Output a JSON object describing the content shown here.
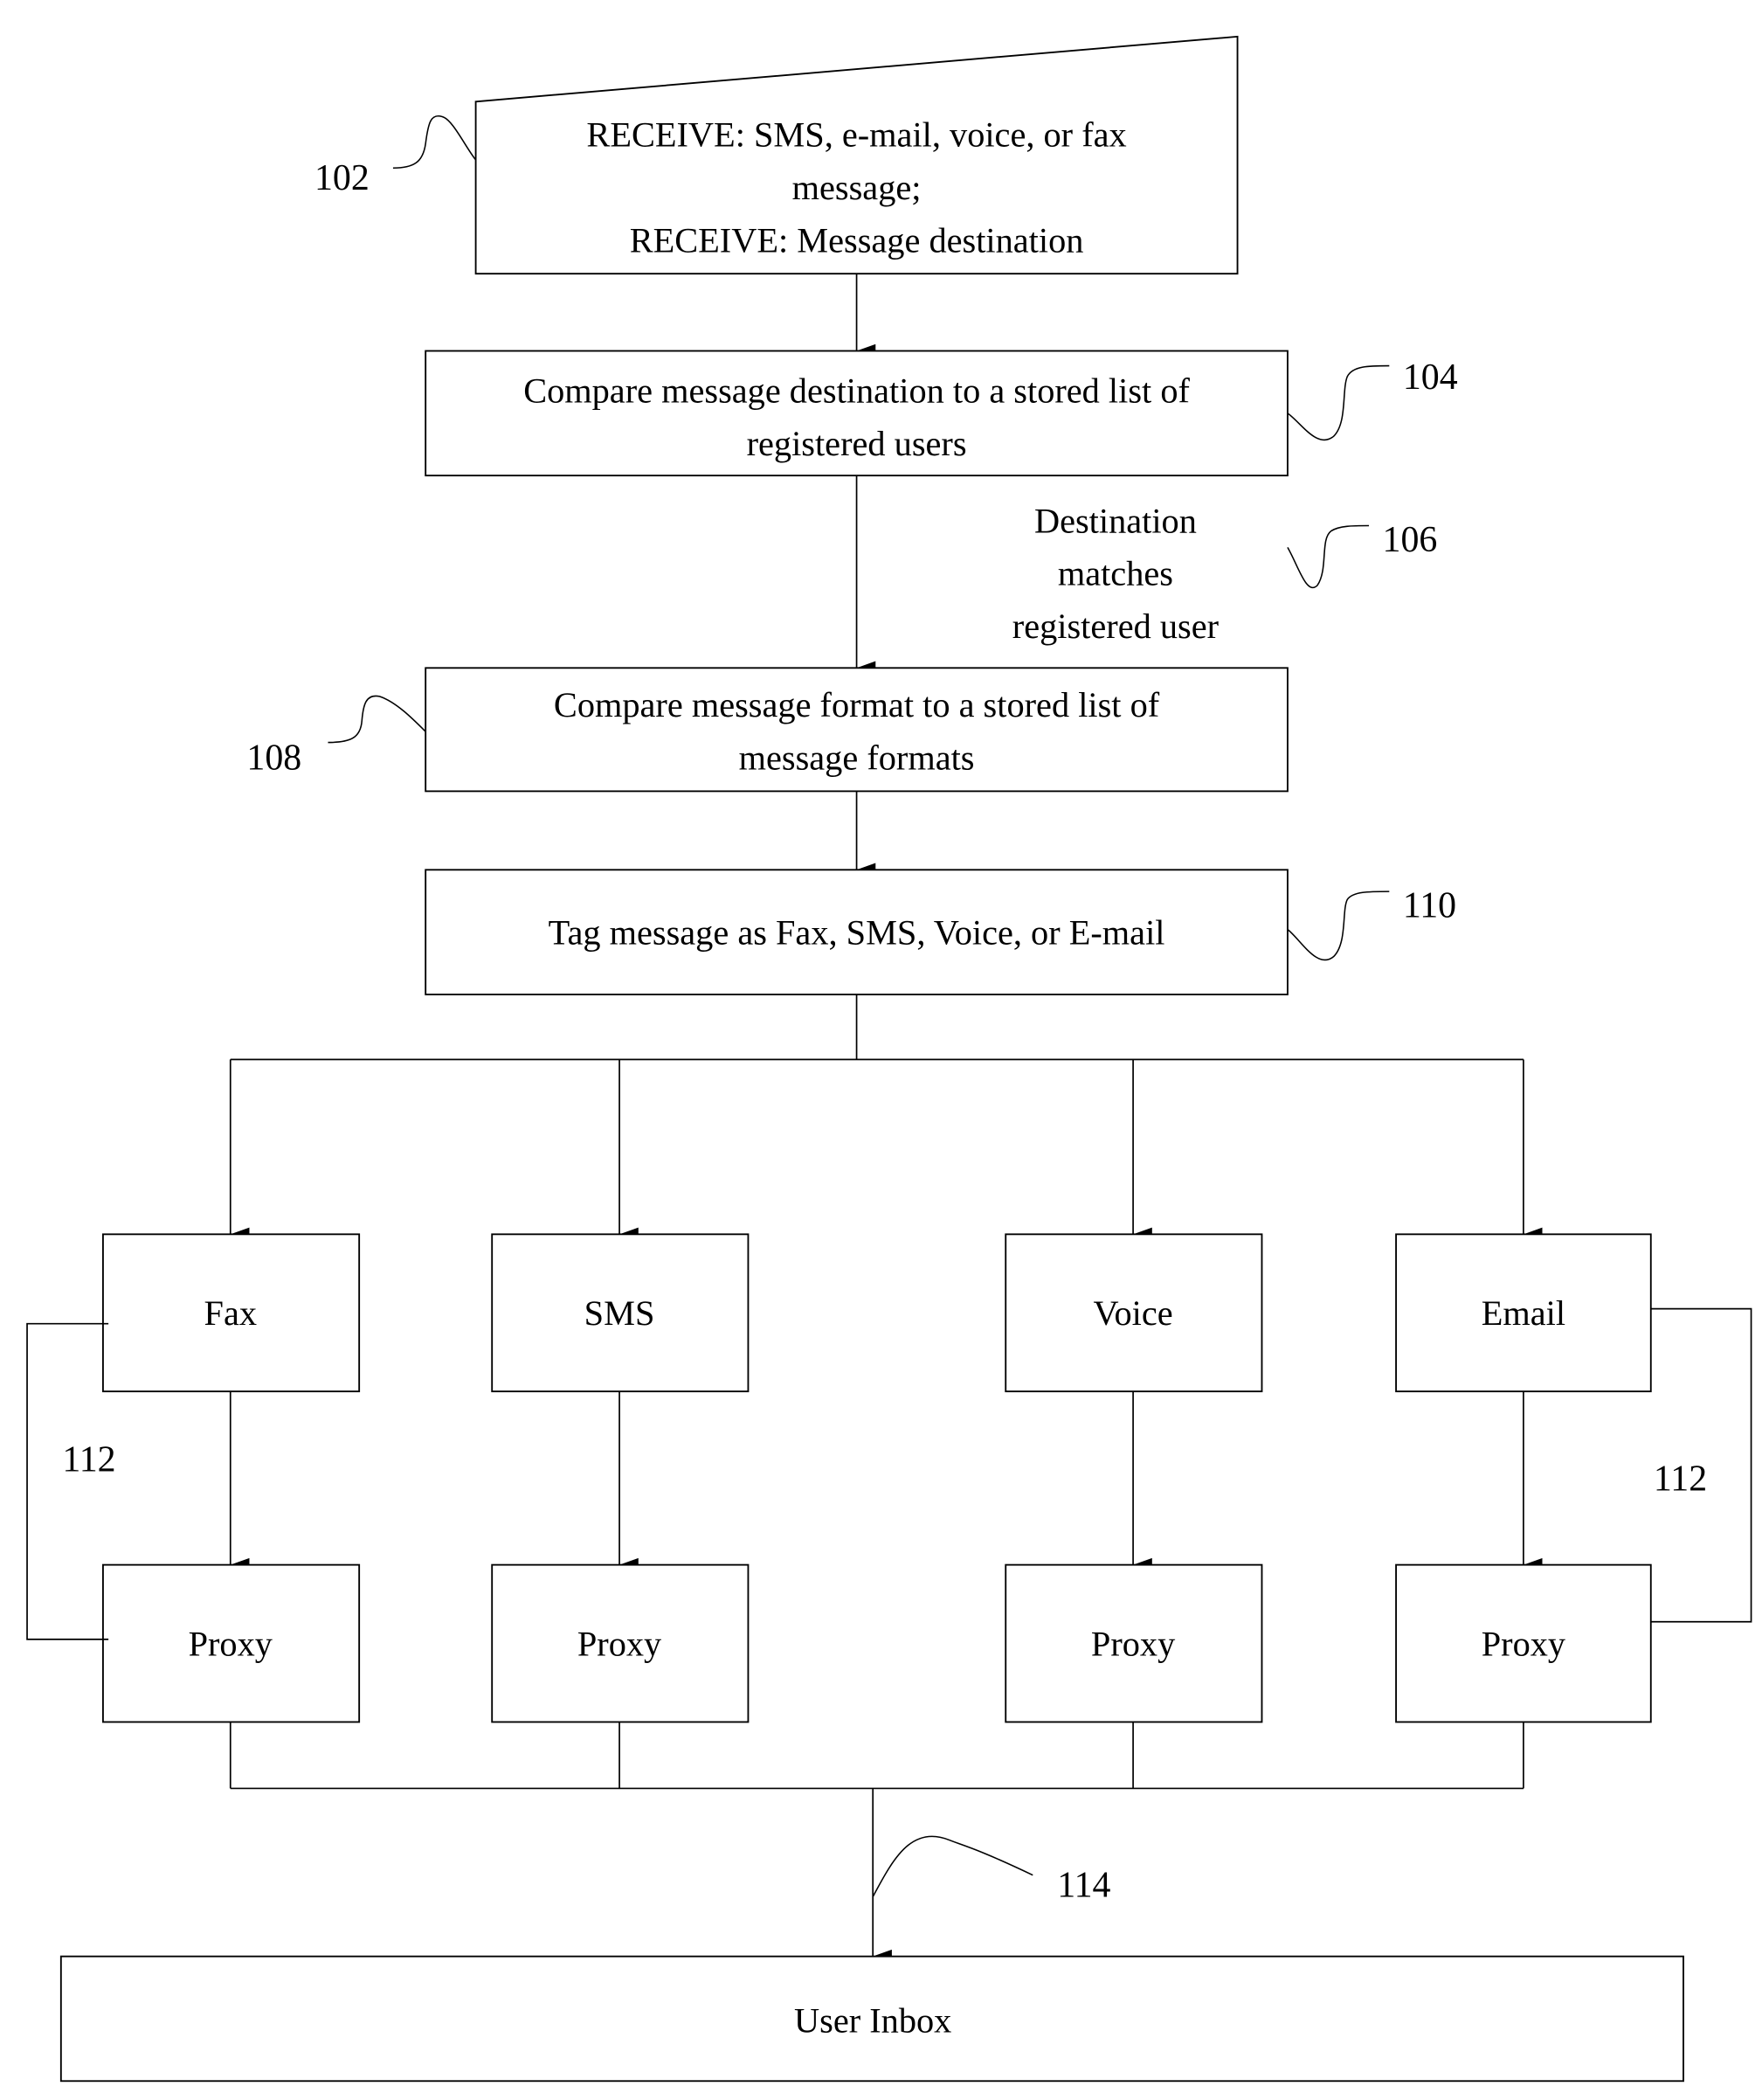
{
  "diagram": {
    "type": "flowchart",
    "steps": {
      "receive": {
        "ref": "102",
        "lines": [
          "RECEIVE: SMS, e-mail, voice, or fax",
          "message;",
          "RECEIVE: Message destination"
        ]
      },
      "compare_destination": {
        "ref": "104",
        "lines": [
          "Compare message destination to a stored list of",
          "registered users"
        ]
      },
      "condition": {
        "ref": "106",
        "lines": [
          "Destination",
          "matches",
          "registered user"
        ]
      },
      "compare_format": {
        "ref": "108",
        "lines": [
          "Compare message format to a stored list of",
          "message formats"
        ]
      },
      "tag": {
        "ref": "110",
        "lines": [
          "Tag message as Fax, SMS, Voice, or E-mail"
        ]
      }
    },
    "branches": [
      {
        "type": "Fax",
        "proxy": "Proxy"
      },
      {
        "type": "SMS",
        "proxy": "Proxy"
      },
      {
        "type": "Voice",
        "proxy": "Proxy"
      },
      {
        "type": "Email",
        "proxy": "Proxy"
      }
    ],
    "bypass_ref_left": "112",
    "bypass_ref_right": "112",
    "merge_ref": "114",
    "inbox": "User Inbox"
  }
}
